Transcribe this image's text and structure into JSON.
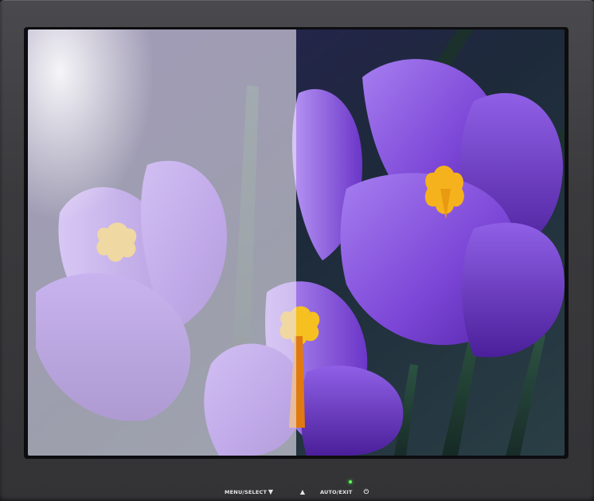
{
  "monitor": {
    "bezel_color": "#3a3a3d",
    "screen": {
      "content": "purple crocus flowers photo",
      "split_view": [
        "washed-out",
        "vivid"
      ],
      "accent_colors": {
        "petal_vivid": "#7a3fd0",
        "petal_faded": "#cdb8ec",
        "stamen": "#f4b21a",
        "stem": "#1f3b2e"
      }
    },
    "controls": {
      "menu_select": "MENU/SELECT",
      "down_glyph": "▼",
      "up_glyph": "▲",
      "auto_exit": "AUTO/EXIT",
      "power_glyph": "⏻",
      "power_led_color": "#5bff5b"
    }
  }
}
